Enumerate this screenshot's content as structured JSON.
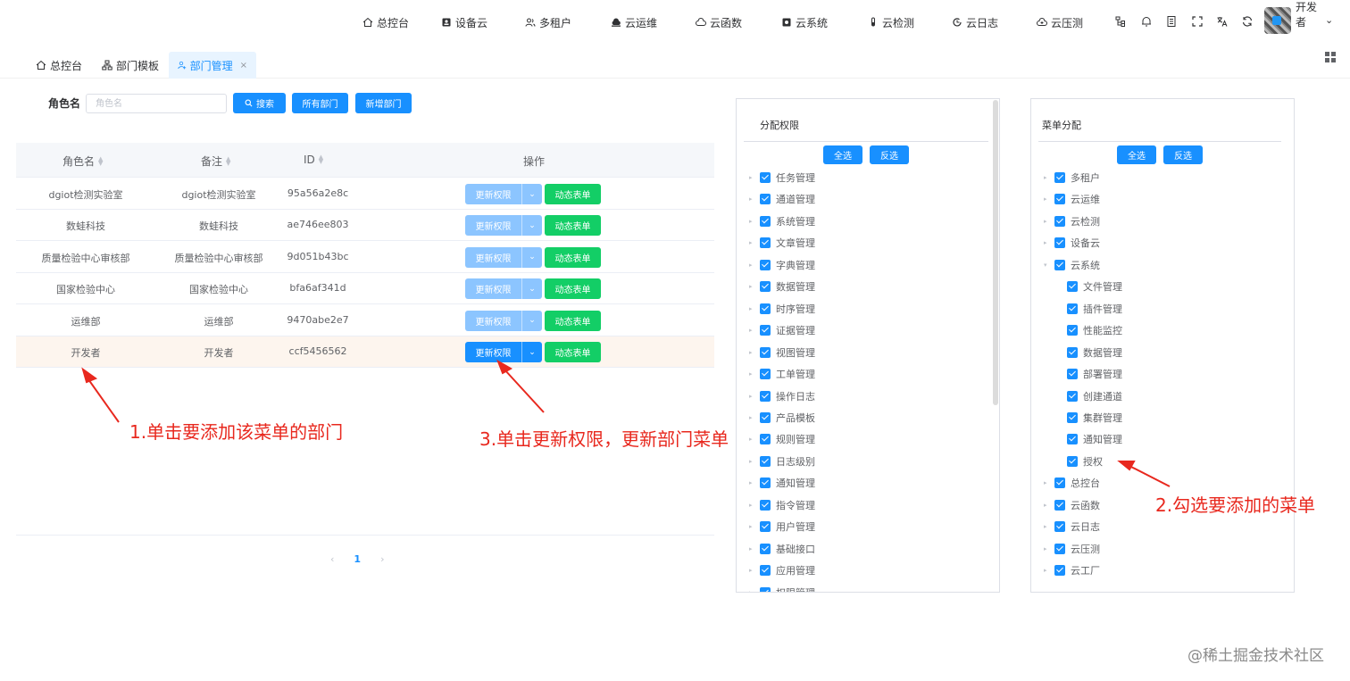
{
  "topnav": {
    "items": [
      {
        "label": "总控台",
        "icon": "home-icon"
      },
      {
        "label": "设备云",
        "icon": "device-icon"
      },
      {
        "label": "多租户",
        "icon": "users-icon"
      },
      {
        "label": "云运维",
        "icon": "cloud-ops-icon"
      },
      {
        "label": "云函数",
        "icon": "cloud-icon"
      },
      {
        "label": "云系统",
        "icon": "system-icon"
      },
      {
        "label": "云检测",
        "icon": "test-tube-icon"
      },
      {
        "label": "云日志",
        "icon": "log-icon"
      },
      {
        "label": "云压测",
        "icon": "cloud-stress-icon"
      }
    ],
    "user": {
      "name": "开发者"
    }
  },
  "tags": [
    {
      "label": "总控台",
      "icon": "home-icon"
    },
    {
      "label": "部门模板",
      "icon": "org-tree-icon"
    },
    {
      "label": "部门管理",
      "icon": "user-add-icon",
      "active": true,
      "close": "×"
    }
  ],
  "search": {
    "label": "角色名",
    "placeholder": "角色名",
    "value": "",
    "search_btn": "搜索",
    "all_btn": "所有部门",
    "add_btn": "新增部门"
  },
  "table": {
    "headers": [
      "角色名",
      "备注",
      "ID",
      "操作"
    ],
    "rows": [
      {
        "name": "dgiot检测实验室",
        "remark": "dgiot检测实验室",
        "id": "95a56a2e8c"
      },
      {
        "name": "数蛙科技",
        "remark": "数蛙科技",
        "id": "ae746ee803"
      },
      {
        "name": "质量检验中心审核部",
        "remark": "质量检验中心审核部",
        "id": "9d051b43bc"
      },
      {
        "name": "国家检验中心",
        "remark": "国家检验中心",
        "id": "bfa6af341d"
      },
      {
        "name": "运维部",
        "remark": "运维部",
        "id": "9470abe2e7"
      },
      {
        "name": "开发者",
        "remark": "开发者",
        "id": "ccf5456562"
      }
    ],
    "update_label": "更新权限",
    "form_label": "动态表单",
    "selected_row": 5
  },
  "pager": {
    "prev": "‹",
    "current": "1",
    "next": "›"
  },
  "annotations": {
    "a1": "1.单击要添加该菜单的部门",
    "a2": "2.勾选要添加的菜单",
    "a3": "3.单击更新权限，更新部门菜单"
  },
  "perm_panel": {
    "title": "分配权限",
    "select_all": "全选",
    "invert": "反选",
    "items": [
      "任务管理",
      "通道管理",
      "系统管理",
      "文章管理",
      "字典管理",
      "数据管理",
      "时序管理",
      "证据管理",
      "视图管理",
      "工单管理",
      "操作日志",
      "产品模板",
      "规则管理",
      "日志级别",
      "通知管理",
      "指令管理",
      "用户管理",
      "基础接口",
      "应用管理",
      "权限管理"
    ]
  },
  "menu_panel": {
    "title": "菜单分配",
    "select_all": "全选",
    "invert": "反选",
    "top_before": [
      "多租户",
      "云运维",
      "云检测",
      "设备云"
    ],
    "expanded": "云系统",
    "children": [
      "文件管理",
      "插件管理",
      "性能监控",
      "数据管理",
      "部署管理",
      "创建通道",
      "集群管理",
      "通知管理",
      "授权"
    ],
    "top_after": [
      "总控台",
      "云函数",
      "云日志",
      "云压测",
      "云工厂"
    ]
  },
  "watermark": "@稀土掘金技术社区",
  "colors": {
    "primary": "#1890ff",
    "primary_light": "#8cc5ff",
    "success": "#13ce66",
    "annotation": "#e8281e",
    "row_highlight": "#fdf5ee"
  }
}
